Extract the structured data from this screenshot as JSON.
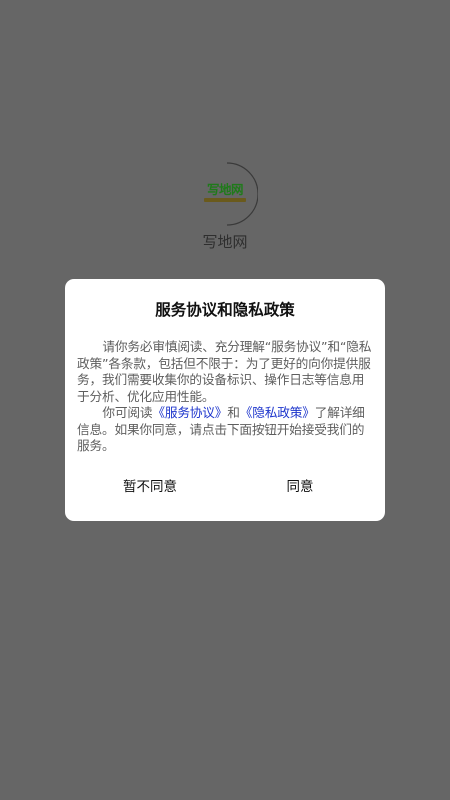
{
  "splash": {
    "logo_text": "写地网",
    "app_name": "写地网"
  },
  "dialog": {
    "title": "服务协议和隐私政策",
    "paragraph1": "请你务必审慎阅读、充分理解“服务协议”和“隐私政策”各条款，包括但不限于：为了更好的向你提供服务，我们需要收集你的设备标识、操作日志等信息用于分析、优化应用性能。",
    "paragraph2_prefix": "你可阅读",
    "service_link": "《服务协议》",
    "conjunction": "和",
    "privacy_link": "《隐私政策》",
    "paragraph2_suffix": "了解详细信息。如果你同意，请点击下面按钮开始接受我们的服务。",
    "disagree_label": "暂不同意",
    "agree_label": "同意"
  },
  "colors": {
    "overlay": "#666666",
    "dialog_background": "#ffffff",
    "link": "#1d35cc",
    "logo_green": "#1f7a1a"
  },
  "icons": {
    "loading_ring": "loading-ring-icon"
  }
}
